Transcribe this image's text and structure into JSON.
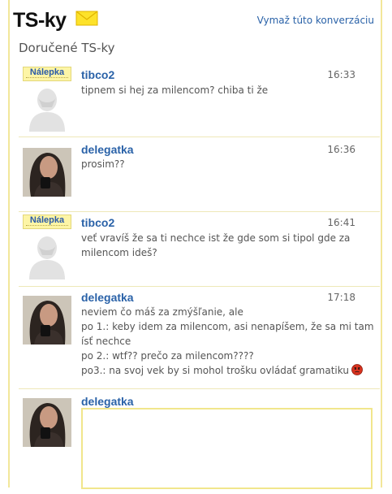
{
  "header": {
    "logo_text": "TS-ky",
    "clear_label": "Vymaž túto konverzáciu"
  },
  "page_title": "Doručené TS-ky",
  "sticker_label": "Nálepka",
  "messages": [
    {
      "user": "tibco2",
      "time": "16:33",
      "has_sticker": true,
      "avatar": "placeholder-avatar",
      "lines": [
        "tipnem si hej za milencom? chiba ti že"
      ]
    },
    {
      "user": "delegatka",
      "time": "16:36",
      "has_sticker": false,
      "avatar": "photo-avatar",
      "lines": [
        "prosim??"
      ]
    },
    {
      "user": "tibco2",
      "time": "16:41",
      "has_sticker": true,
      "avatar": "placeholder-avatar",
      "lines": [
        "veť vravíš že sa ti nechce ist že gde som si tipol gde za",
        "milencom ideš?"
      ]
    },
    {
      "user": "delegatka",
      "time": "17:18",
      "has_sticker": false,
      "avatar": "photo-avatar",
      "lines": [
        "neviem čo máš za zmýšľanie, ale",
        "po 1.: keby idem za milencom, asi nenapíšem, že sa mi tam",
        "ísť nechce",
        "po 2.: wtf?? prečo za milencom????",
        "po3.: na svoj vek by si mohol trošku ovládať gramatiku"
      ]
    }
  ],
  "reply": {
    "user": "delegatka",
    "value": ""
  },
  "colors": {
    "link": "#2a62a8",
    "sticker_bg": "#fdf5a6",
    "border": "#f2e79a",
    "emoji": "#d9331f"
  }
}
